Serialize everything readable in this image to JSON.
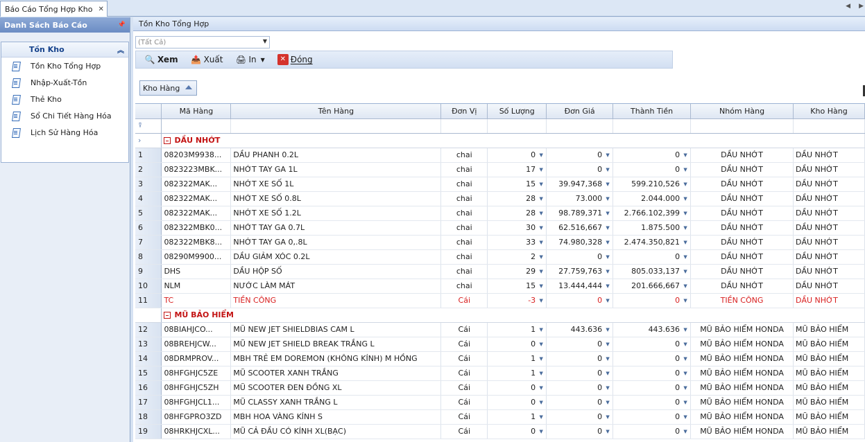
{
  "doc_tab": {
    "title": "Báo Cáo Tổng Hợp Kho",
    "close": "✕"
  },
  "left_panel": {
    "title": "Danh Sách Báo Cáo",
    "pin": "📌",
    "group": {
      "title": "Tồn Kho",
      "collapse": "︽",
      "items": [
        {
          "label": "Tồn Kho Tổng Hợp"
        },
        {
          "label": "Nhập-Xuất-Tồn"
        },
        {
          "label": "Thẻ Kho"
        },
        {
          "label": "Sổ Chi Tiết Hàng Hóa"
        },
        {
          "label": "Lịch Sử Hàng Hóa"
        }
      ]
    }
  },
  "right_panel": {
    "title": "Tồn Kho Tổng Hợp",
    "filter": {
      "value": "(Tất Cả)"
    },
    "toolbar": {
      "view": "Xem",
      "export": "Xuất",
      "print": "In",
      "close": "Đóng"
    },
    "group_chip": "Kho Hàng"
  },
  "grid": {
    "columns": [
      "Mã Hàng",
      "Tên Hàng",
      "Đơn Vị",
      "Số Lượng",
      "Đơn Giá",
      "Thành Tiền",
      "Nhóm Hàng",
      "Kho Hàng"
    ],
    "groups": [
      {
        "title": "DẦU NHỚT",
        "rows": [
          {
            "no": "1",
            "code": "08203M9938...",
            "name": "DẦU PHANH 0.2L",
            "unit": "chai",
            "qty": "0",
            "price": "0",
            "amount": "0",
            "group": "DẦU NHỚT",
            "store": "DẦU NHỚT"
          },
          {
            "no": "2",
            "code": "0823223MBK...",
            "name": "NHỚT TAY GA 1L",
            "unit": "chai",
            "qty": "17",
            "price": "0",
            "amount": "0",
            "group": "DẦU NHỚT",
            "store": "DẦU NHỚT"
          },
          {
            "no": "3",
            "code": "082322MAK...",
            "name": "NHỚT XE SỐ 1L",
            "unit": "chai",
            "qty": "15",
            "price": "39.947,368",
            "amount": "599.210,526",
            "group": "DẦU NHỚT",
            "store": "DẦU NHỚT"
          },
          {
            "no": "4",
            "code": "082322MAK...",
            "name": "NHỚT XE SỐ 0.8L",
            "unit": "chai",
            "qty": "28",
            "price": "73.000",
            "amount": "2.044.000",
            "group": "DẦU NHỚT",
            "store": "DẦU NHỚT"
          },
          {
            "no": "5",
            "code": "082322MAK...",
            "name": "NHỚT XE SỐ 1.2L",
            "unit": "chai",
            "qty": "28",
            "price": "98.789,371",
            "amount": "2.766.102,399",
            "group": "DẦU NHỚT",
            "store": "DẦU NHỚT"
          },
          {
            "no": "6",
            "code": "082322MBK0...",
            "name": "NHỚT TAY GA 0.7L",
            "unit": "chai",
            "qty": "30",
            "price": "62.516,667",
            "amount": "1.875.500",
            "group": "DẦU NHỚT",
            "store": "DẦU NHỚT"
          },
          {
            "no": "7",
            "code": "082322MBK8...",
            "name": "NHỚT TAY GA 0,.8L",
            "unit": "chai",
            "qty": "33",
            "price": "74.980,328",
            "amount": "2.474.350,821",
            "group": "DẦU NHỚT",
            "store": "DẦU NHỚT"
          },
          {
            "no": "8",
            "code": "08290M9900...",
            "name": "DẦU GIẢM XÓC 0.2L",
            "unit": "chai",
            "qty": "2",
            "price": "0",
            "amount": "0",
            "group": "DẦU NHỚT",
            "store": "DẦU NHỚT"
          },
          {
            "no": "9",
            "code": "DHS",
            "name": "DẦU HỘP SỐ",
            "unit": "chai",
            "qty": "29",
            "price": "27.759,763",
            "amount": "805.033,137",
            "group": "DẦU NHỚT",
            "store": "DẦU NHỚT"
          },
          {
            "no": "10",
            "code": "NLM",
            "name": "NƯỚC LÀM MÁT",
            "unit": "chai",
            "qty": "15",
            "price": "13.444,444",
            "amount": "201.666,667",
            "group": "DẦU NHỚT",
            "store": "DẦU NHỚT"
          },
          {
            "no": "11",
            "code": "TC",
            "name": "TIỀN CÔNG",
            "unit": "Cái",
            "qty": "-3",
            "price": "0",
            "amount": "0",
            "group": "TIỀN CÔNG",
            "store": "DẦU NHỚT",
            "red": true
          }
        ]
      },
      {
        "title": "MŨ BẢO HIỂM",
        "rows": [
          {
            "no": "12",
            "code": "08BIAHJCO...",
            "name": "MŨ NEW JET SHIELDBIAS CAM L",
            "unit": "Cái",
            "qty": "1",
            "price": "443.636",
            "amount": "443.636",
            "group": "MŨ BẢO HIỂM HONDA",
            "store": "MŨ BẢO HIỂM"
          },
          {
            "no": "13",
            "code": "08BREHJCW...",
            "name": "MŨ NEW JET SHIELD BREAK TRẮNG L",
            "unit": "Cái",
            "qty": "0",
            "price": "0",
            "amount": "0",
            "group": "MŨ BẢO HIỂM HONDA",
            "store": "MŨ BẢO HIỂM"
          },
          {
            "no": "14",
            "code": "08DRMPROV...",
            "name": "MBH TRẺ EM DOREMON (KHÔNG KÍNH) M HỒNG",
            "unit": "Cái",
            "qty": "1",
            "price": "0",
            "amount": "0",
            "group": "MŨ BẢO HIỂM HONDA",
            "store": "MŨ BẢO HIỂM"
          },
          {
            "no": "15",
            "code": "08HFGHJC5ZE",
            "name": "MŨ SCOOTER XANH TRẮNG",
            "unit": "Cái",
            "qty": "1",
            "price": "0",
            "amount": "0",
            "group": "MŨ BẢO HIỂM HONDA",
            "store": "MŨ BẢO HIỂM"
          },
          {
            "no": "16",
            "code": "08HFGHJC5ZH",
            "name": "MŨ SCOOTER ĐEN ĐỒNG XL",
            "unit": "Cái",
            "qty": "0",
            "price": "0",
            "amount": "0",
            "group": "MŨ BẢO HIỂM HONDA",
            "store": "MŨ BẢO HIỂM"
          },
          {
            "no": "17",
            "code": "08HFGHJCL1...",
            "name": "MŨ CLASSY XANH TRẮNG L",
            "unit": "Cái",
            "qty": "0",
            "price": "0",
            "amount": "0",
            "group": "MŨ BẢO HIỂM HONDA",
            "store": "MŨ BẢO HIỂM"
          },
          {
            "no": "18",
            "code": "08HFGPRO3ZD",
            "name": "MBH HOA VÀNG KÍNH S",
            "unit": "Cái",
            "qty": "1",
            "price": "0",
            "amount": "0",
            "group": "MŨ BẢO HIỂM HONDA",
            "store": "MŨ BẢO HIỂM"
          },
          {
            "no": "19",
            "code": "08HRKHJCXL...",
            "name": "MŨ CẢ ĐẦU CÓ KÍNH XL(BẠC)",
            "unit": "Cái",
            "qty": "0",
            "price": "0",
            "amount": "0",
            "group": "MŨ BẢO HIỂM HONDA",
            "store": "MŨ BẢO HIỂM"
          }
        ]
      }
    ]
  }
}
